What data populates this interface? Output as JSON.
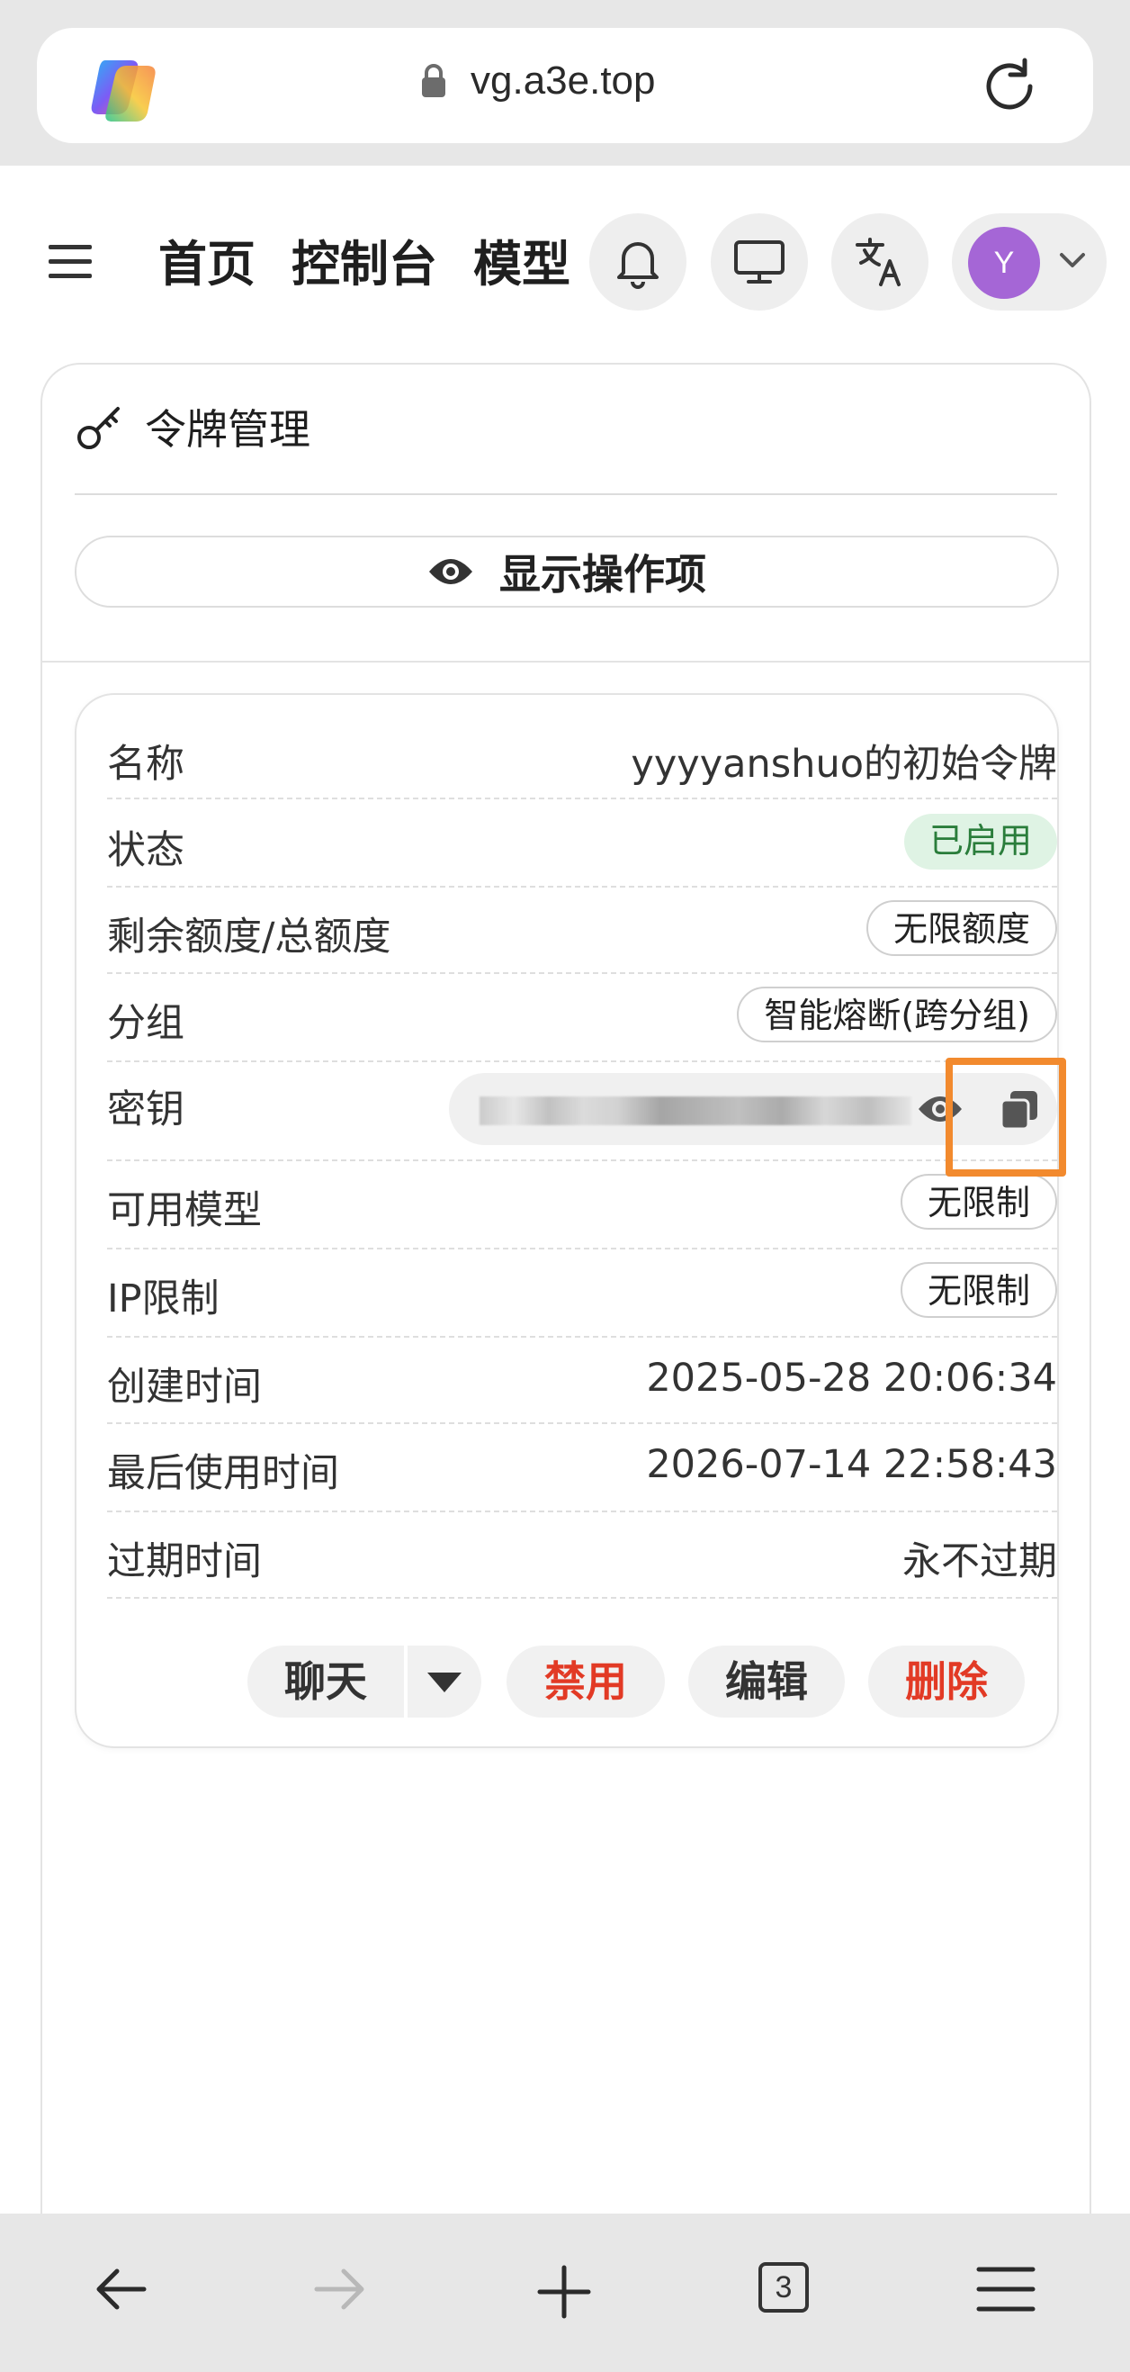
{
  "browser": {
    "url": "vg.a3e.top",
    "tabs_count": "3"
  },
  "nav": {
    "links": [
      "首页",
      "控制台",
      "模型"
    ],
    "avatar_initial": "Y"
  },
  "panel": {
    "title": "令牌管理",
    "show_actions_label": "显示操作项"
  },
  "token": {
    "rows": {
      "name": {
        "label": "名称",
        "value": "yyyyanshuo的初始令牌"
      },
      "status": {
        "label": "状态",
        "value": "已启用"
      },
      "quota": {
        "label": "剩余额度/总额度",
        "value": "无限额度"
      },
      "group": {
        "label": "分组",
        "value": "智能熔断(跨分组)"
      },
      "key": {
        "label": "密钥"
      },
      "models": {
        "label": "可用模型",
        "value": "无限制"
      },
      "ip": {
        "label": "IP限制",
        "value": "无限制"
      },
      "created": {
        "label": "创建时间",
        "value": "2025-05-28 20:06:34"
      },
      "last_used": {
        "label": "最后使用时间",
        "value": "2026-07-14 22:58:43"
      },
      "expires": {
        "label": "过期时间",
        "value": "永不过期"
      }
    },
    "actions": {
      "chat": "聊天",
      "disable": "禁用",
      "edit": "编辑",
      "delete": "删除"
    }
  },
  "colors": {
    "accent_highlight": "#f28a2e",
    "danger": "#e23a25",
    "status_green_bg": "#dff3e4",
    "status_green_text": "#2a7d3b",
    "avatar": "#a566d6"
  },
  "icons": [
    "browser-logo-icon",
    "lock-icon",
    "reload-icon",
    "hamburger-icon",
    "bell-icon",
    "monitor-icon",
    "translate-icon",
    "chevron-down-icon",
    "key-icon",
    "eye-icon",
    "copy-icon",
    "caret-down-icon",
    "back-arrow-icon",
    "forward-arrow-icon",
    "plus-icon",
    "tabs-icon",
    "menu-icon"
  ]
}
